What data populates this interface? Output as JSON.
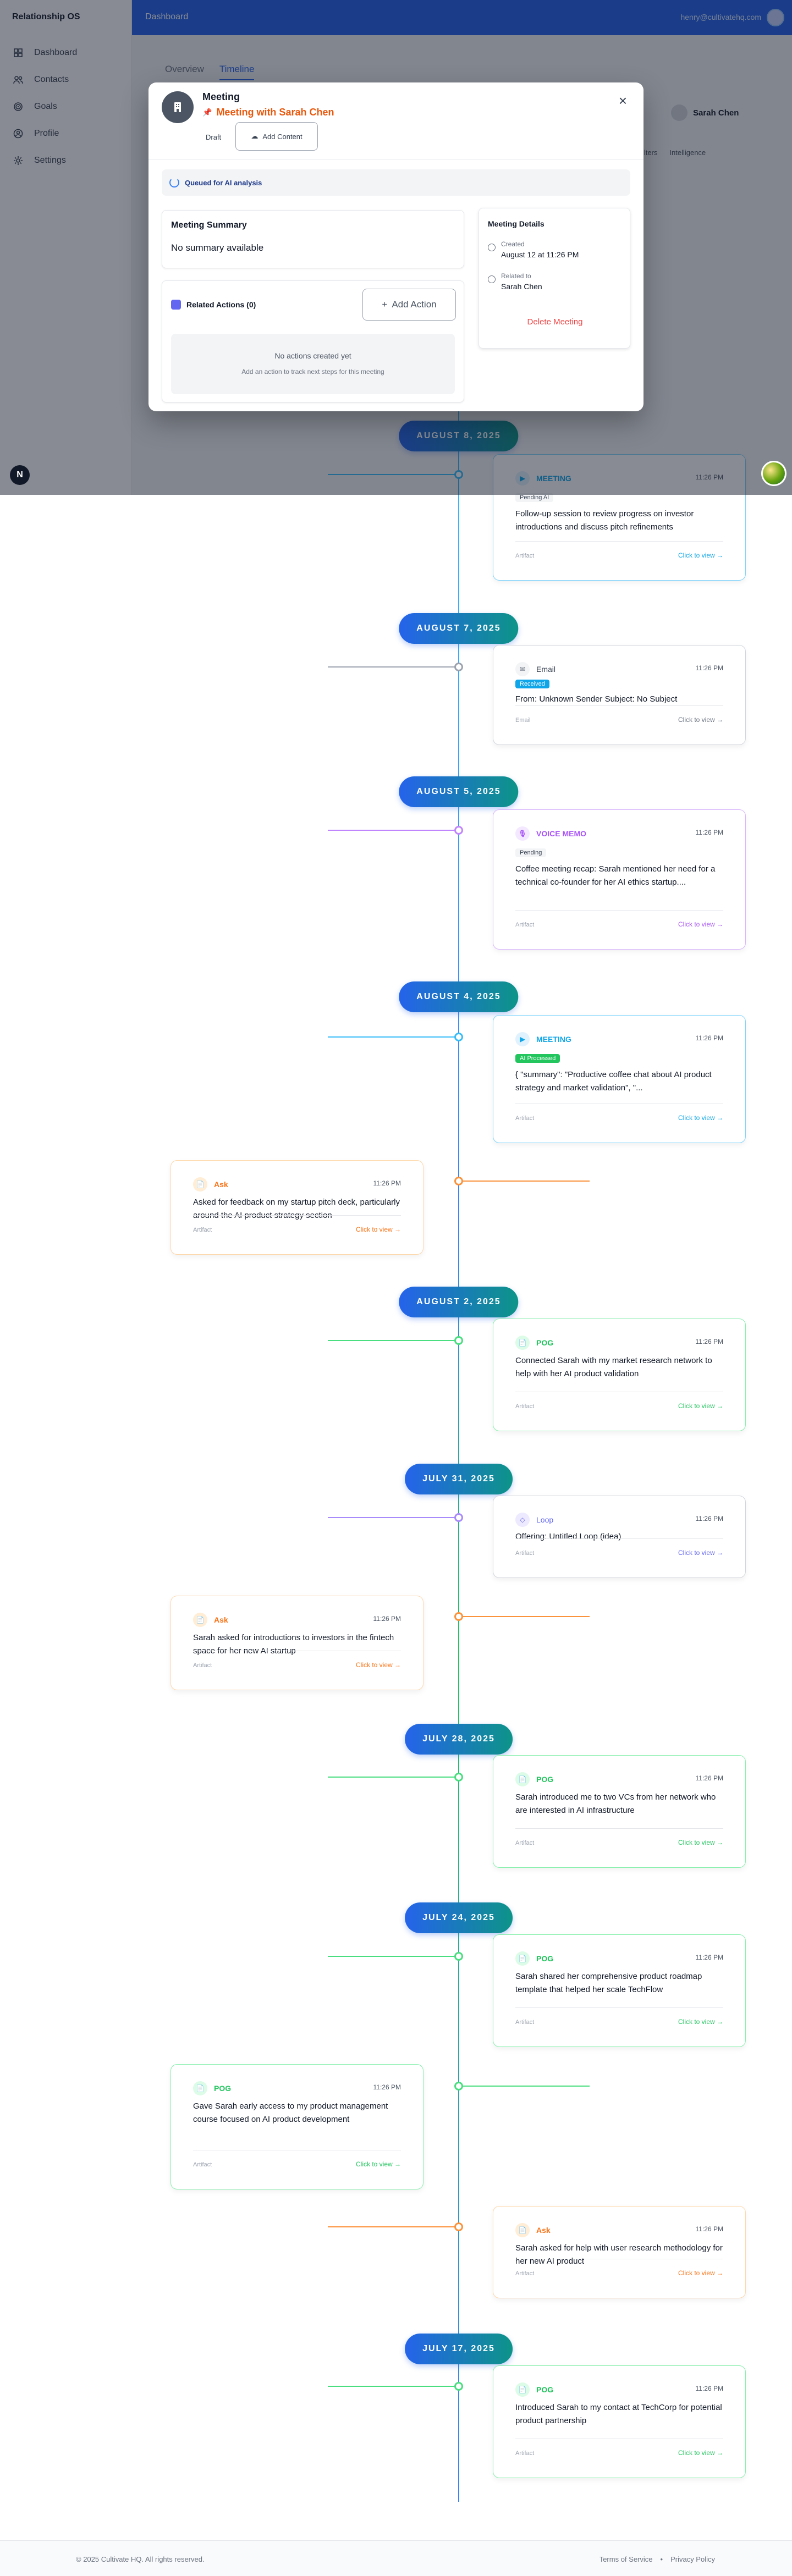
{
  "sidebar": {
    "title": "Relationship OS",
    "items": [
      {
        "label": "Dashboard",
        "icon": "grid-icon"
      },
      {
        "label": "Contacts",
        "icon": "users-icon"
      },
      {
        "label": "Goals",
        "icon": "target-icon"
      },
      {
        "label": "Profile",
        "icon": "user-circle-icon"
      },
      {
        "label": "Settings",
        "icon": "gear-icon"
      }
    ],
    "help_label": "N"
  },
  "topbar": {
    "title": "Dashboard",
    "email": "henry@cultivatehq.com"
  },
  "tabs": {
    "overview": "Overview",
    "timeline": "Timeline"
  },
  "contact": {
    "name": "Sarah Chen"
  },
  "filters": {
    "filters_label": "Filters",
    "intelligence_label": "Intelligence"
  },
  "modal": {
    "type_label": "Meeting",
    "title": "Meeting with Sarah Chen",
    "status": "Draft",
    "add_content_label": "Add Content",
    "queue_label": "Queued for AI analysis",
    "summary_title": "Meeting Summary",
    "summary_text": "No summary available",
    "actions_title": "Related Actions (0)",
    "add_action_label": "Add Action",
    "empty_title": "No actions created yet",
    "empty_hint": "Add an action to track next steps for this meeting",
    "details_title": "Meeting Details",
    "created_label": "Created",
    "created_value": "August 12 at 11:26 PM",
    "related_label": "Related to",
    "related_value": "Sarah Chen",
    "delete_label": "Delete Meeting"
  },
  "timeline": {
    "dates": [
      "AUGUST 8, 2025",
      "AUGUST 7, 2025",
      "AUGUST 5, 2025",
      "AUGUST 4, 2025",
      "AUGUST 2, 2025",
      "JULY 31, 2025",
      "JULY 28, 2025",
      "JULY 24, 2025",
      "JULY 17, 2025"
    ],
    "cards": [
      {
        "kind": "meet",
        "label": "MEETING",
        "time": "11:26 PM",
        "badge": "Pending AI",
        "text": "Follow-up session to review progress on investor introductions and discuss pitch refinements",
        "foot": "Artifact",
        "cta": "Click to view →"
      },
      {
        "kind": "email",
        "label": "Email",
        "time": "11:26 PM",
        "badge": "Received",
        "text": "From: Unknown Sender Subject: No Subject",
        "foot": "Email",
        "cta": "Click to view →"
      },
      {
        "kind": "voice",
        "label": "VOICE MEMO",
        "time": "11:26 PM",
        "badge": "Pending",
        "text": "Coffee meeting recap: Sarah mentioned her need for a technical co-founder for her AI ethics startup....",
        "foot": "Artifact",
        "cta": "Click to view →"
      },
      {
        "kind": "meet",
        "label": "MEETING",
        "time": "11:26 PM",
        "badge": "AI Processed",
        "text": "{ \"summary\": \"Productive coffee chat about AI product strategy and market validation\", \"...",
        "foot": "Artifact",
        "cta": "Click to view →"
      },
      {
        "kind": "ask",
        "label": "Ask",
        "time": "11:26 PM",
        "text": "Asked for feedback on my startup pitch deck, particularly around the AI product strategy section",
        "foot": "Artifact",
        "cta": "Click to view →"
      },
      {
        "kind": "pog",
        "label": "POG",
        "time": "11:26 PM",
        "text": "Connected Sarah with my market research network to help with her AI product validation",
        "foot": "Artifact",
        "cta": "Click to view →"
      },
      {
        "kind": "loop",
        "label": "Loop",
        "time": "11:26 PM",
        "text": "Offering: Untitled Loop (idea)",
        "foot": "Artifact",
        "cta": "Click to view →"
      },
      {
        "kind": "ask",
        "label": "Ask",
        "time": "11:26 PM",
        "text": "Sarah asked for introductions to investors in the fintech space for her new AI startup",
        "foot": "Artifact",
        "cta": "Click to view →"
      },
      {
        "kind": "pog",
        "label": "POG",
        "time": "11:26 PM",
        "text": "Sarah introduced me to two VCs from her network who are interested in AI infrastructure",
        "foot": "Artifact",
        "cta": "Click to view →"
      },
      {
        "kind": "pog",
        "label": "POG",
        "time": "11:26 PM",
        "text": "Sarah shared her comprehensive product roadmap template that helped her scale TechFlow",
        "foot": "Artifact",
        "cta": "Click to view →"
      },
      {
        "kind": "pog",
        "label": "POG",
        "time": "11:26 PM",
        "text": "Gave Sarah early access to my product management course focused on AI product development",
        "foot": "Artifact",
        "cta": "Click to view →"
      },
      {
        "kind": "ask",
        "label": "Ask",
        "time": "11:26 PM",
        "text": "Sarah asked for help with user research methodology for her new AI product",
        "foot": "Artifact",
        "cta": "Click to view →"
      },
      {
        "kind": "pog",
        "label": "POG",
        "time": "11:26 PM",
        "text": "Introduced Sarah to my contact at TechCorp for potential product partnership",
        "foot": "Artifact",
        "cta": "Click to view →"
      }
    ]
  },
  "footer": {
    "copyright": "© 2025 Cultivate HQ. All rights reserved.",
    "terms": "Terms of Service",
    "separator": "•",
    "privacy": "Privacy Policy"
  }
}
